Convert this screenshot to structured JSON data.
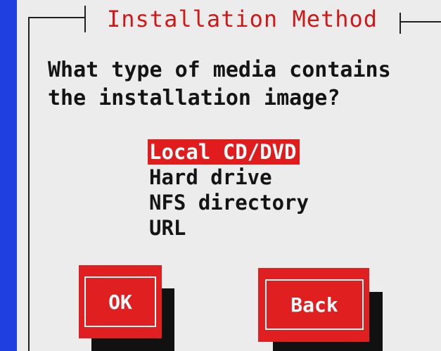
{
  "dialog": {
    "title": "Installation Method",
    "prompt": "What type of media contains\nthe installation image?"
  },
  "menu": {
    "items": [
      {
        "label": "Local CD/DVD",
        "selected": true
      },
      {
        "label": "Hard drive",
        "selected": false
      },
      {
        "label": "NFS directory",
        "selected": false
      },
      {
        "label": "URL",
        "selected": false
      }
    ]
  },
  "buttons": {
    "ok_label": "OK",
    "back_label": "Back"
  },
  "colors": {
    "background": "#1f3fe0",
    "dialog": "#ececec",
    "accent": "#e01c1c",
    "text": "#141414"
  }
}
